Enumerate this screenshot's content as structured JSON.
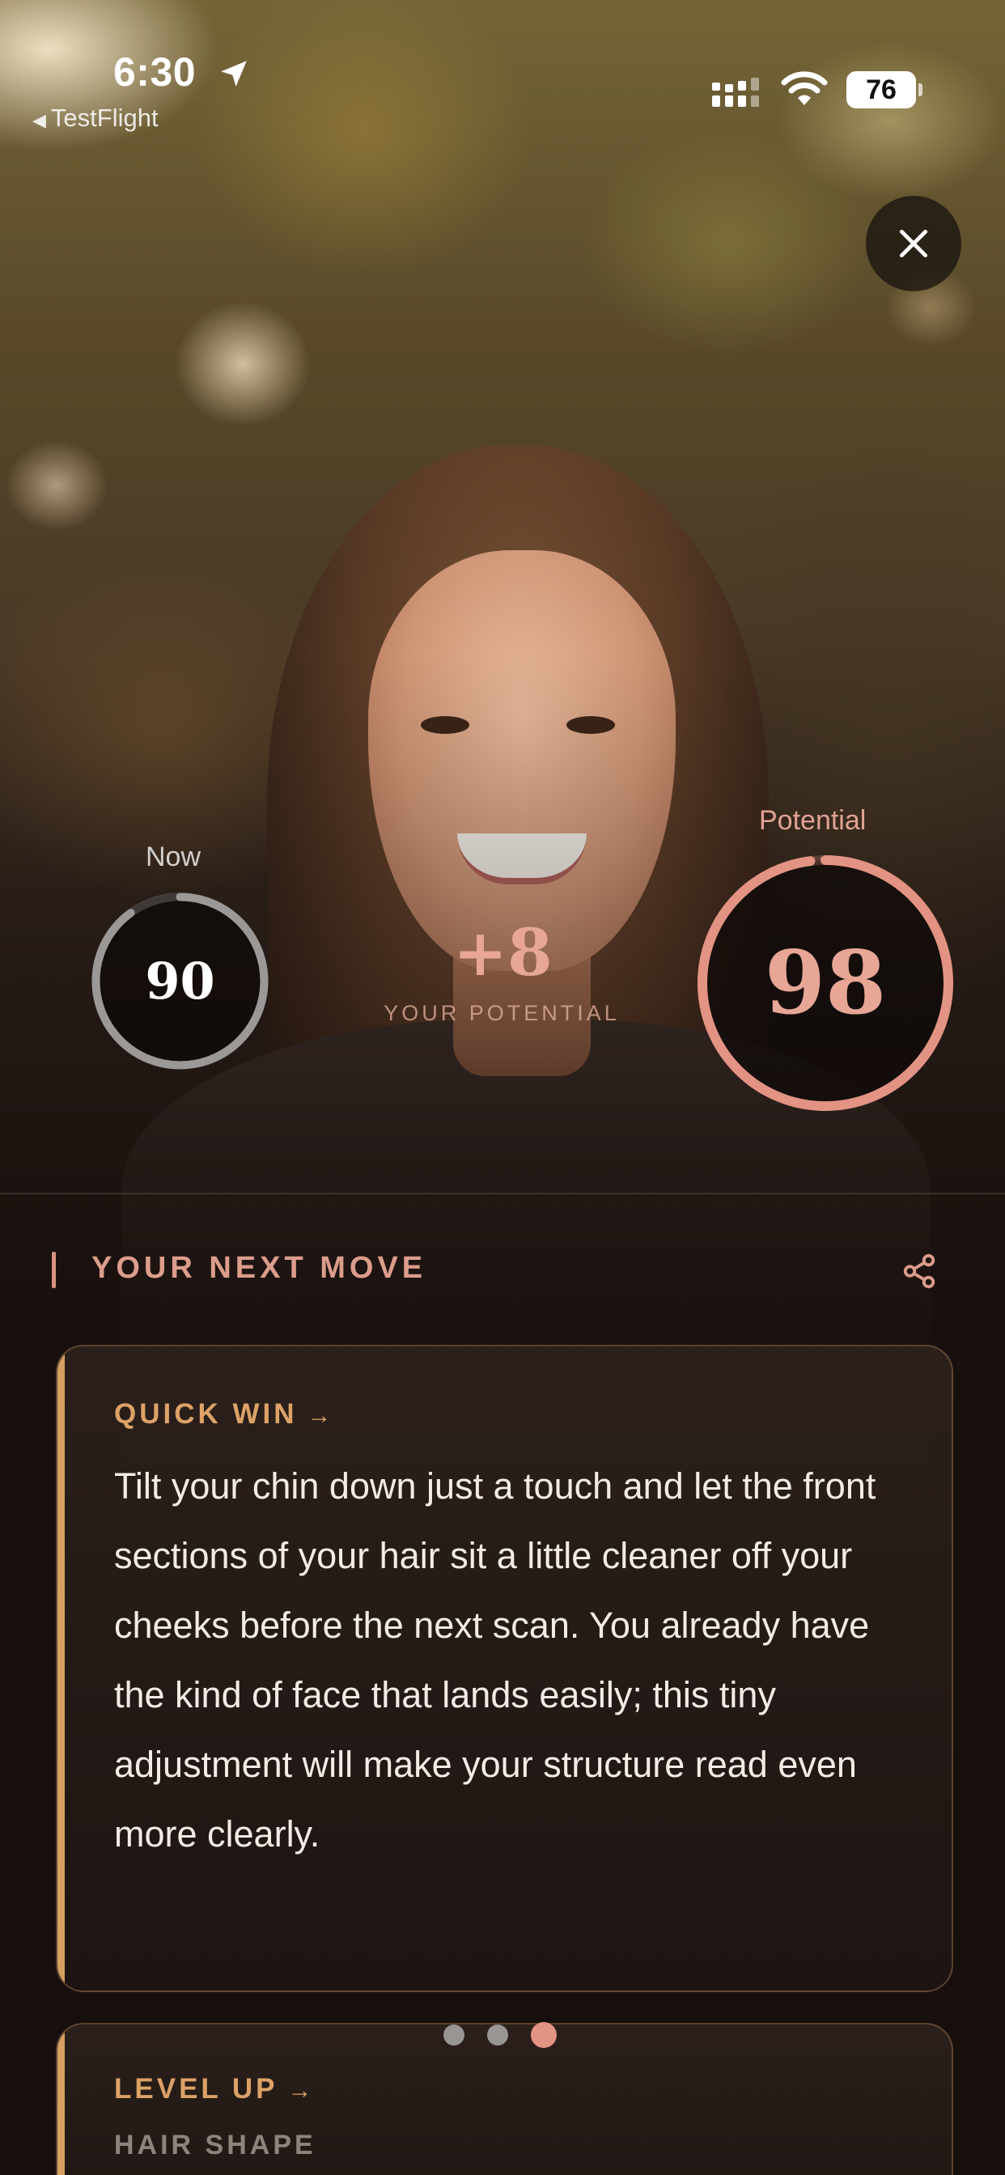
{
  "status_bar": {
    "time": "6:30",
    "back_app": "TestFlight",
    "battery": "76"
  },
  "scores": {
    "now_label": "Now",
    "now_value": "90",
    "now_progress": 0.9,
    "potential_label": "Potential",
    "potential_value": "98",
    "potential_progress": 0.98,
    "delta": "+8",
    "delta_caption": "YOUR POTENTIAL"
  },
  "section": {
    "title": "YOUR NEXT MOVE"
  },
  "cards": [
    {
      "kicker": "QUICK WIN",
      "arrow": "→",
      "body": "Tilt your chin down just a touch and let the front sections of your hair sit a little cleaner off your cheeks before the next scan. You already have the kind of face that lands easily; this tiny adjustment will make your structure read even more clearly."
    },
    {
      "kicker": "LEVEL UP",
      "arrow": "→",
      "subtitle": "HAIR SHAPE"
    }
  ],
  "pager": {
    "count": 3,
    "active_index": 2
  },
  "colors": {
    "accent_rose": "#e39383",
    "accent_gold": "#d6a062",
    "background": "#170f0c"
  },
  "icons": {
    "location": "location-arrow-icon",
    "signal": "cellular-signal-icon",
    "wifi": "wifi-icon",
    "close": "close-icon",
    "share": "share-icon"
  }
}
